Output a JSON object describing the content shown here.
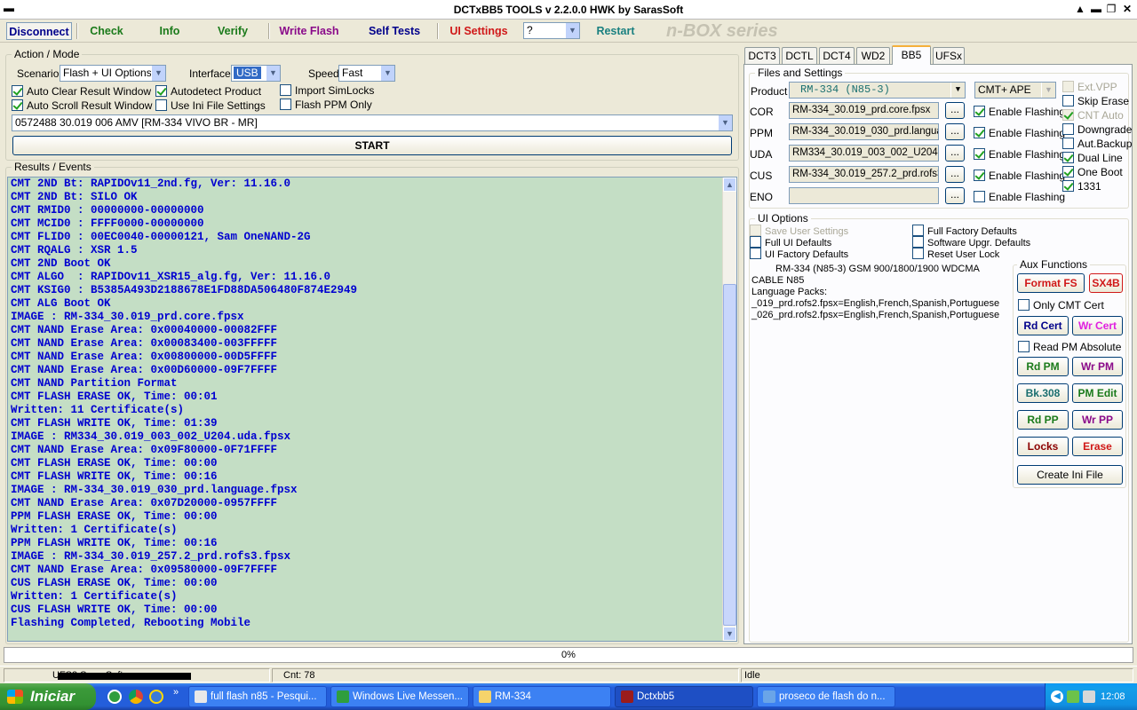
{
  "window": {
    "title": "DCTxBB5 TOOLS v 2.2.0.0 HWK by SarasSoft"
  },
  "toolbar": {
    "disconnect": "Disconnect",
    "check": "Check",
    "info": "Info",
    "verify": "Verify",
    "write_flash": "Write Flash",
    "self_tests": "Self Tests",
    "ui_settings": "UI Settings",
    "help_select": "?",
    "restart": "Restart",
    "nbox": "n-BOX series"
  },
  "action_mode": {
    "title": "Action / Mode",
    "scenario_label": "Scenario",
    "scenario_value": "Flash + UI Options",
    "interface_label": "Interface",
    "interface_value": "USB",
    "speed_label": "Speed",
    "speed_value": "Fast",
    "auto_clear": "Auto Clear Result Window",
    "autodetect": "Autodetect Product",
    "import_simlocks": "Import SimLocks",
    "auto_scroll": "Auto Scroll Result Window",
    "use_ini": "Use Ini File Settings",
    "flash_ppm": "Flash PPM Only",
    "firmware_value": "0572488 30.019 006 AMV [RM-334 VIVO BR - MR]",
    "start": "START"
  },
  "results": {
    "title": "Results / Events",
    "lines": [
      "CMT 2ND Bt: RAPIDOv11_2nd.fg, Ver: 11.16.0",
      "CMT 2ND Bt: SILO OK",
      "CMT RMID0 : 00000000-00000000",
      "CMT MCID0 : FFFF0000-00000000",
      "CMT FLID0 : 00EC0040-00000121, Sam OneNAND-2G",
      "CMT RQALG : XSR 1.5",
      "CMT 2ND Boot OK",
      "CMT ALGO  : RAPIDOv11_XSR15_alg.fg, Ver: 11.16.0",
      "CMT KSIG0 : B5385A493D2188678E1FD88DA506480F874E2949",
      "CMT ALG Boot OK",
      "IMAGE : RM-334_30.019_prd.core.fpsx",
      "CMT NAND Erase Area: 0x00040000-00082FFF",
      "CMT NAND Erase Area: 0x00083400-003FFFFF",
      "CMT NAND Erase Area: 0x00800000-00D5FFFF",
      "CMT NAND Erase Area: 0x00D60000-09F7FFFF",
      "CMT NAND Partition Format",
      "CMT FLASH ERASE OK, Time: 00:01",
      "Written: 11 Certificate(s)",
      "CMT FLASH WRITE OK, Time: 01:39",
      "IMAGE : RM334_30.019_003_002_U204.uda.fpsx",
      "CMT NAND Erase Area: 0x09F80000-0F71FFFF",
      "CMT FLASH ERASE OK, Time: 00:00",
      "CMT FLASH WRITE OK, Time: 00:16",
      "IMAGE : RM-334_30.019_030_prd.language.fpsx",
      "CMT NAND Erase Area: 0x07D20000-0957FFFF",
      "PPM FLASH ERASE OK, Time: 00:00",
      "Written: 1 Certificate(s)",
      "PPM FLASH WRITE OK, Time: 00:16",
      "IMAGE : RM-334_30.019_257.2_prd.rofs3.fpsx",
      "CMT NAND Erase Area: 0x09580000-09F7FFFF",
      "CUS FLASH ERASE OK, Time: 00:00",
      "Written: 1 Certificate(s)",
      "CUS FLASH WRITE OK, Time: 00:00",
      "Flashing Completed, Rebooting Mobile"
    ]
  },
  "tabs": [
    "DCT3",
    "DCTL",
    "DCT4",
    "WD2",
    "BB5",
    "UFSx"
  ],
  "files": {
    "title": "Files and Settings",
    "product_label": "Product",
    "product_value": "RM-334  (N85-3)",
    "cmt_value": "CMT+ APE",
    "ext_vpp": "Ext.VPP",
    "skip_erase": "Skip Erase",
    "cnt_auto": "CNT Auto",
    "downgrade": "Downgrade",
    "aut_backup": "Aut.Backup",
    "dual_line": "Dual Line",
    "one_boot": "One Boot",
    "n1331": "1331",
    "enable_flashing": "Enable Flashing",
    "dots": "...",
    "rows": [
      {
        "label": "COR",
        "value": "RM-334_30.019_prd.core.fpsx"
      },
      {
        "label": "PPM",
        "value": "RM-334_30.019_030_prd.languag"
      },
      {
        "label": "UDA",
        "value": "RM334_30.019_003_002_U204.u"
      },
      {
        "label": "CUS",
        "value": "RM-334_30.019_257.2_prd.rofs3.f"
      },
      {
        "label": "ENO",
        "value": ""
      }
    ]
  },
  "ui_options": {
    "title": "UI Options",
    "save_user": "Save User Settings",
    "full_factory": "Full Factory Defaults",
    "full_ui": "Full UI Defaults",
    "software_upgr": "Software Upgr. Defaults",
    "ui_factory": "UI Factory Defaults",
    "reset_user_lock": "Reset User Lock"
  },
  "device_info": {
    "line1": "RM-334 (N85-3) GSM 900/1800/1900 WDCMA",
    "line2": "CABLE N85",
    "line3": "Language Packs:",
    "line4": "_019_prd.rofs2.fpsx=English,French,Spanish,Portuguese",
    "line5": "_026_prd.rofs2.fpsx=English,French,Spanish,Portuguese"
  },
  "aux": {
    "title": "Aux Functions",
    "format_fs": "Format FS",
    "sx4b": "SX4B",
    "only_cmt_cert": "Only CMT Cert",
    "rd_cert": "Rd Cert",
    "wr_cert": "Wr Cert",
    "read_pm_absolute": "Read PM Absolute",
    "rd_pm": "Rd PM",
    "wr_pm": "Wr PM",
    "bk308": "Bk.308",
    "pm_edit": "PM Edit",
    "rd_pp": "Rd PP",
    "wr_pp": "Wr PP",
    "locks": "Locks",
    "erase": "Erase",
    "create_ini": "Create Ini File"
  },
  "progress": {
    "text": "0%",
    "value": 0
  },
  "status": {
    "user": "UFS3 SarasSoft",
    "cnt": "Cnt: 78",
    "state": "Idle"
  },
  "taskbar": {
    "start": "Iniciar",
    "items": [
      {
        "label": "full flash n85 - Pesqui..."
      },
      {
        "label": "Windows Live Messen..."
      },
      {
        "label": "RM-334"
      },
      {
        "label": "Dctxbb5"
      },
      {
        "label": "proseco de flash do n..."
      }
    ],
    "clock": "12:08"
  },
  "colors": {
    "log_bg": "#c4dec5",
    "log_text": "#0000d0",
    "red_btn": "#d01818",
    "green_btn": "#1a7a1a",
    "purple_btn": "#8a0a8a"
  }
}
